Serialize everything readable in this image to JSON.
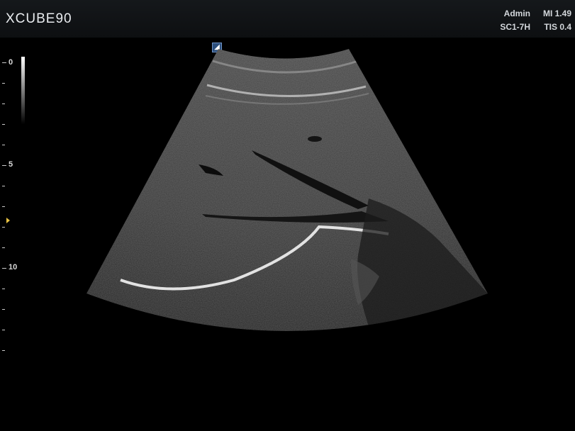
{
  "header": {
    "brand": "XCUBE90",
    "user": "Admin",
    "mi": "MI 1.49",
    "probe": "SC1-7H",
    "tis": "TIS 0.4"
  },
  "depth_scale": {
    "labels": [
      "0",
      "5",
      "10"
    ]
  },
  "orientation_marker": {
    "glyph": "◢"
  },
  "colors": {
    "background": "#000000",
    "header_bg": "#101214",
    "focus_marker": "#e8c243",
    "orientation_marker": "#2c4f7d"
  },
  "image": {
    "description_icon": "ultrasound-sector-icon"
  }
}
